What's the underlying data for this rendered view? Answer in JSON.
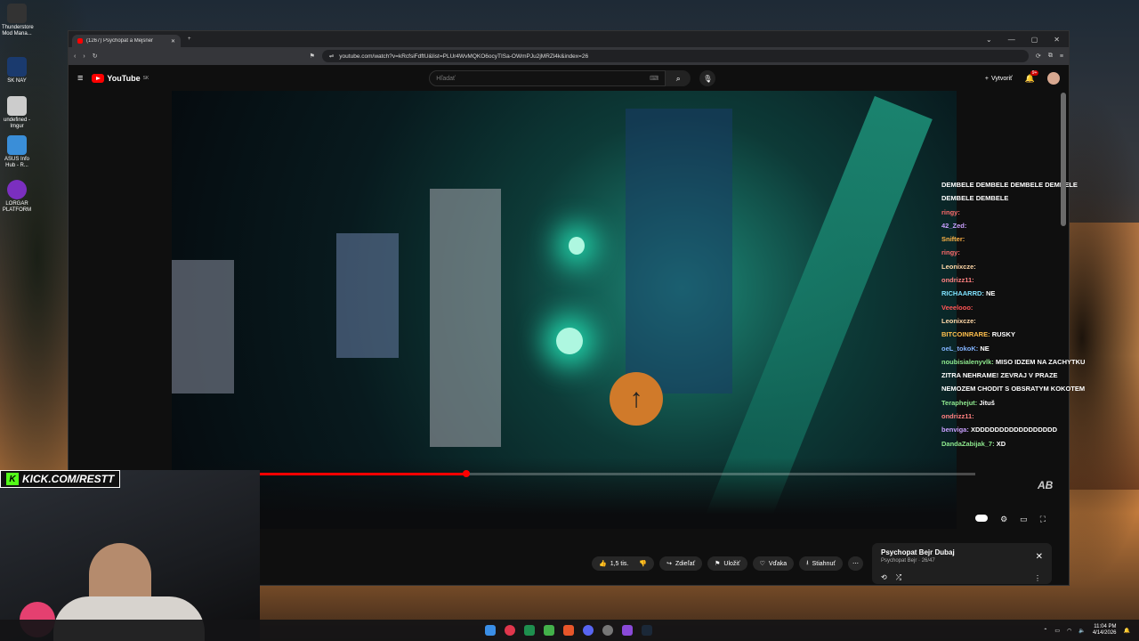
{
  "desktop": {
    "icons": [
      {
        "label": "Thunderstore Mod Mana..."
      },
      {
        "label": "SK NAY"
      },
      {
        "label": "undefined - Imgur"
      },
      {
        "label": "ASUS Info Hub - R..."
      },
      {
        "label": "LORGAR PLATFORM"
      }
    ]
  },
  "browser": {
    "tab_title": "(1267) Psychopat a Mejsner",
    "url": "youtube.com/watch?v=kRcfsiFdftU&list=PLUr4WvMQKO6ocyTISa-OWmPJu2jMRZl4k&index=26"
  },
  "youtube": {
    "logo": "YouTube",
    "region": "SK",
    "search_placeholder": "Hľadať",
    "create_label": "Vytvoriť",
    "notif_count": "9+"
  },
  "player": {
    "progress": 0.35,
    "watermark": "AB"
  },
  "chat": [
    {
      "user": "",
      "text": "DEMBELE DEMBELE DEMBELE DEMBELE DEMBELE DEMBELE",
      "color": "#ffffff"
    },
    {
      "user": "ringy:",
      "text": "",
      "color": "#ff6b6b"
    },
    {
      "user": "42_Zed:",
      "text": "",
      "color": "#c9a0ff"
    },
    {
      "user": "Snifter:",
      "text": "",
      "color": "#ffb347"
    },
    {
      "user": "ringy:",
      "text": "",
      "color": "#ff6b6b"
    },
    {
      "user": "Leonixcze:",
      "text": "",
      "color": "#ffd8a8"
    },
    {
      "user": "ondrizz11:",
      "text": "",
      "color": "#ff8080"
    },
    {
      "user": "RICHAARRD:",
      "text": "NE",
      "color": "#7fe3ff"
    },
    {
      "user": "Veeelooo:",
      "text": "",
      "color": "#ff5555"
    },
    {
      "user": "Leonixcze:",
      "text": "",
      "color": "#ffd8a8"
    },
    {
      "user": "BITCOINRARE:",
      "text": "RUSKY",
      "color": "#ffc04d"
    },
    {
      "user": "oeL_tokoK:",
      "text": "NE",
      "color": "#82b4ff"
    },
    {
      "user": "noubisialenyvlk:",
      "text": "MISO IDZEM NA ZACHYTKU ZITRA NEHRAME! ZEVRAJ V PRAZE NEMOZEM CHODIT S OBSRATYM KOKOTEM",
      "color": "#8ee88e"
    },
    {
      "user": "Teraphejut:",
      "text": "Jituš",
      "color": "#8ee88e"
    },
    {
      "user": "ondrizz11:",
      "text": "",
      "color": "#ff8080"
    },
    {
      "user": "benviga:",
      "text": "XDDDDDDDDDDDDDDDDD",
      "color": "#c9a0ff"
    },
    {
      "user": "DandaZabijak_7:",
      "text": "XD",
      "color": "#8ee88e"
    }
  ],
  "actions": {
    "likes": "1,5 tis.",
    "share": "Zdieľať",
    "save": "Uložiť",
    "thanks": "Vďaka",
    "download": "Stiahnuť"
  },
  "playlist": {
    "title": "Psychopat Bejr  Dubaj",
    "channel": "Psychopat Bejr",
    "position": "26/47"
  },
  "stream": {
    "kick_label": "KICK.COM/RESTT"
  },
  "taskbar": {
    "time": "11:04 PM",
    "date": "4/14/2026"
  }
}
